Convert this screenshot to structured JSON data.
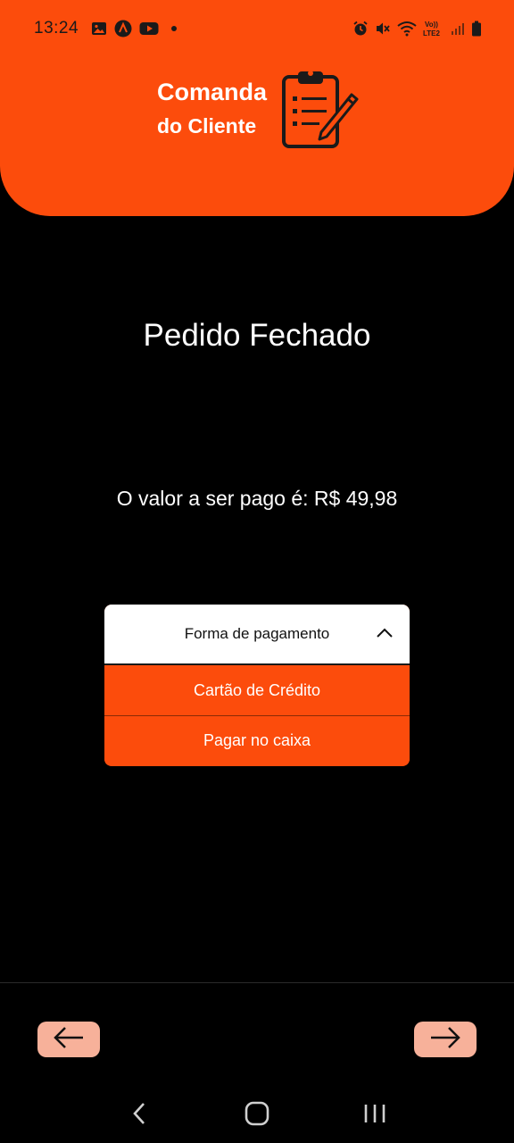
{
  "status_bar": {
    "time": "13:24",
    "left_icons": [
      "image-icon",
      "app-icon",
      "youtube-icon"
    ],
    "right_icons": [
      "alarm-icon",
      "mute-icon",
      "wifi-icon",
      "volte-icon",
      "signal-icon",
      "battery-icon"
    ],
    "volte_text": "VoLTE2"
  },
  "header": {
    "title": "Comanda",
    "subtitle": "do Cliente",
    "logo_icon": "clipboard-pen-icon",
    "background_color": "#fc4c0c"
  },
  "main": {
    "title": "Pedido Fechado",
    "amount_text": "O valor a ser pago é: R$ 49,98"
  },
  "payment_dropdown": {
    "label": "Forma de pagamento",
    "expanded": true,
    "options": [
      {
        "label": "Cartão de Crédito"
      },
      {
        "label": "Pagar no caixa"
      }
    ]
  },
  "footer": {
    "prev_icon": "arrow-left-icon",
    "next_icon": "arrow-right-icon",
    "button_color": "#f7b19a"
  },
  "system_nav": {
    "icons": [
      "back-icon",
      "home-icon",
      "recents-icon"
    ]
  }
}
